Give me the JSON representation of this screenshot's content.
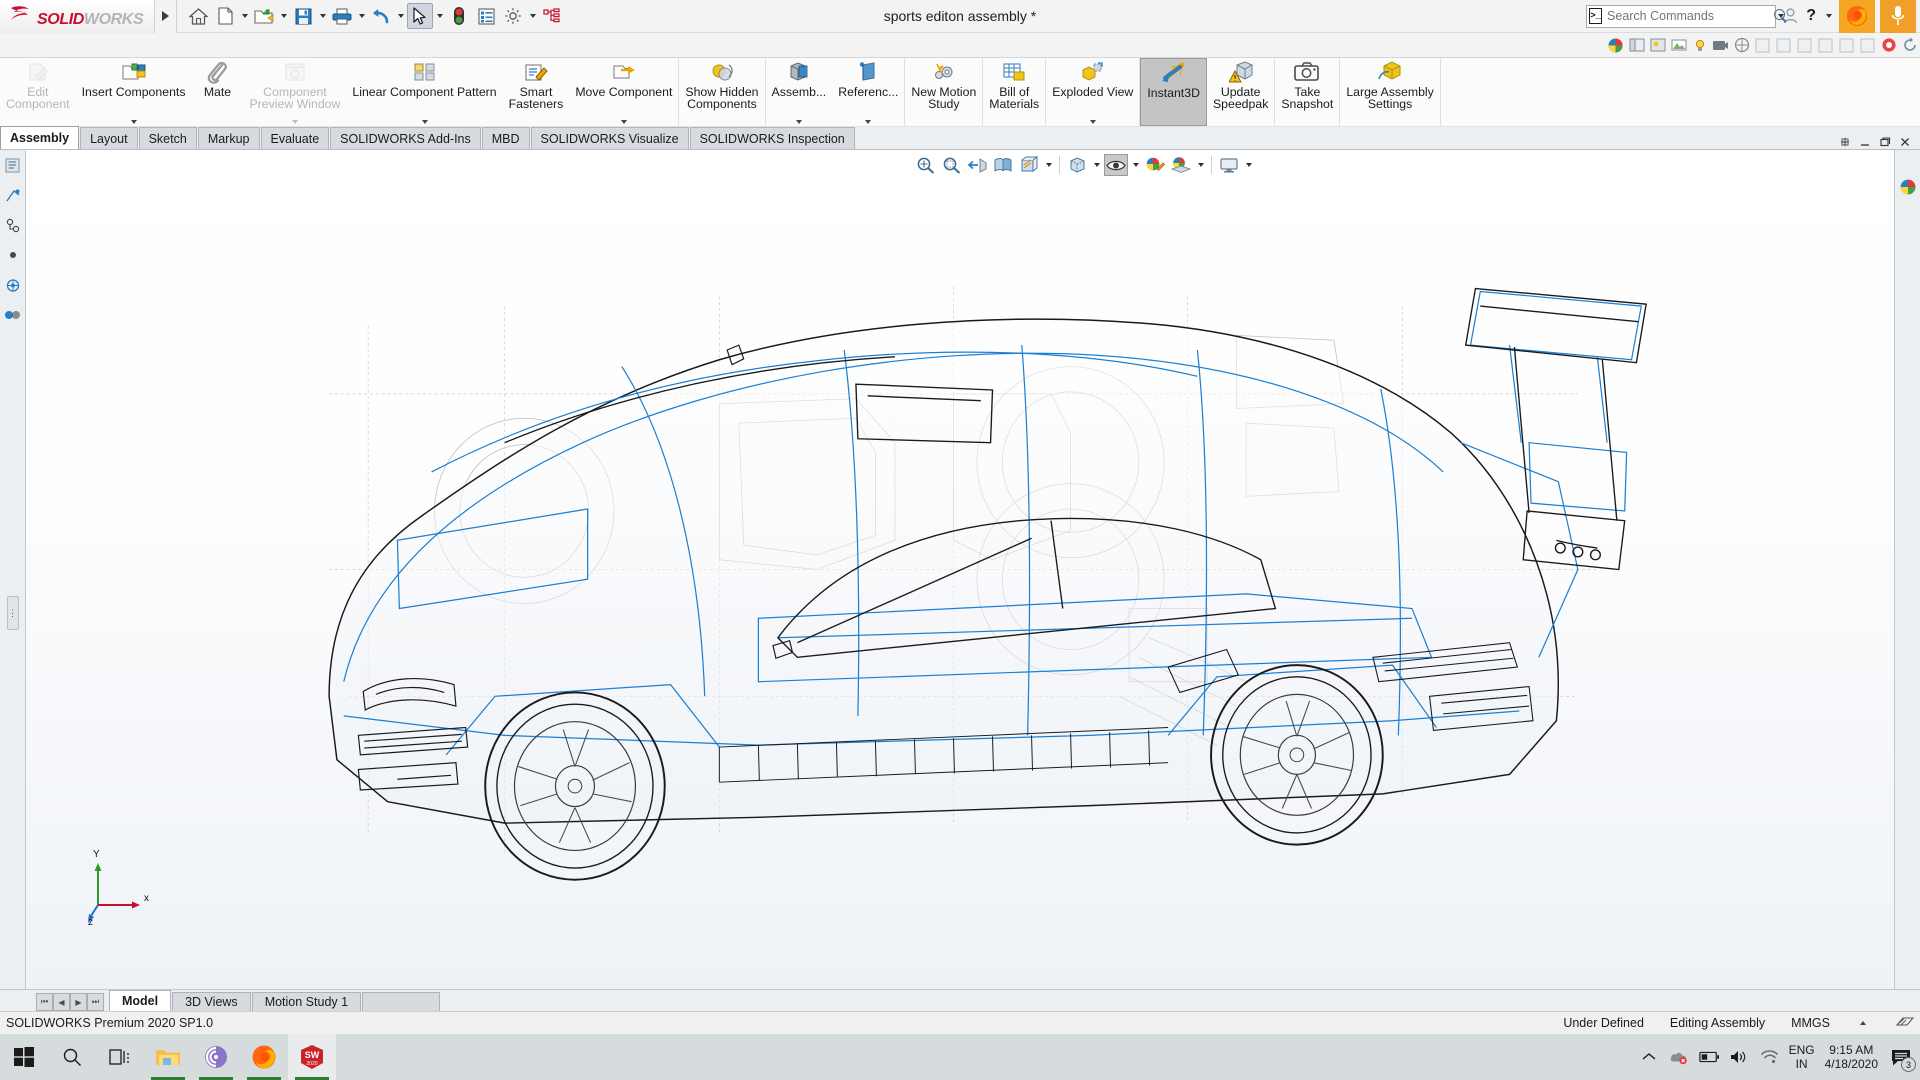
{
  "app": {
    "brand_mark": "3DS",
    "brand_solid": "SOLID",
    "brand_works": "WORKS",
    "window_title": "sports editon assembly *",
    "accent_red": "#c8102e",
    "accent_blue": "#2a7fc1"
  },
  "quick_access": [
    {
      "name": "home-icon",
      "label": "Home",
      "dropdown": false
    },
    {
      "name": "new-document-icon",
      "label": "New",
      "dropdown": true
    },
    {
      "name": "open-folder-icon",
      "label": "Open",
      "dropdown": true
    },
    {
      "name": "save-icon",
      "label": "Save",
      "dropdown": true
    },
    {
      "name": "print-icon",
      "label": "Print",
      "dropdown": true
    },
    {
      "name": "undo-icon",
      "label": "Undo",
      "dropdown": true
    },
    {
      "name": "select-cursor-icon",
      "label": "Select",
      "dropdown": true,
      "selected": true
    },
    {
      "name": "rebuild-icon",
      "label": "Rebuild",
      "dropdown": false
    },
    {
      "name": "options-list-icon",
      "label": "Options List",
      "dropdown": false
    },
    {
      "name": "gear-icon",
      "label": "Options",
      "dropdown": true
    },
    {
      "name": "tree-display-icon",
      "label": "Tree Display",
      "dropdown": false
    }
  ],
  "search": {
    "placeholder": "Search Commands",
    "value": ""
  },
  "title_actions": {
    "user_label": "User",
    "help_label": "?",
    "firefox_label": "Firefox",
    "mic_label": "Microphone"
  },
  "ribbon": {
    "buttons": [
      {
        "label": "Edit\nComponent",
        "name": "edit-component-button",
        "icon": "edit-component-icon",
        "disabled": true,
        "dropdown": false,
        "group_end": false
      },
      {
        "label": "Insert Components",
        "name": "insert-components-button",
        "icon": "insert-components-icon",
        "disabled": false,
        "dropdown": true,
        "group_end": false
      },
      {
        "label": "Mate",
        "name": "mate-button",
        "icon": "paperclip-mate-icon",
        "disabled": false,
        "dropdown": false,
        "group_end": false
      },
      {
        "label": "Component\nPreview Window",
        "name": "component-preview-window-button",
        "icon": "component-preview-icon",
        "disabled": true,
        "dropdown": true,
        "group_end": false
      },
      {
        "label": "Linear Component Pattern",
        "name": "linear-component-pattern-button",
        "icon": "linear-pattern-icon",
        "disabled": false,
        "dropdown": true,
        "group_end": false
      },
      {
        "label": "Smart\nFasteners",
        "name": "smart-fasteners-button",
        "icon": "smart-fasteners-icon",
        "disabled": false,
        "dropdown": false,
        "group_end": false
      },
      {
        "label": "Move Component",
        "name": "move-component-button",
        "icon": "move-component-icon",
        "disabled": false,
        "dropdown": true,
        "group_end": true
      },
      {
        "label": "Show Hidden\nComponents",
        "name": "show-hidden-components-button",
        "icon": "show-hidden-icon",
        "disabled": false,
        "dropdown": false,
        "group_end": true
      },
      {
        "label": "Assemb...",
        "name": "assembly-features-button",
        "icon": "assembly-features-icon",
        "disabled": false,
        "dropdown": true,
        "group_end": false
      },
      {
        "label": "Referenc...",
        "name": "reference-geometry-button",
        "icon": "reference-geometry-icon",
        "disabled": false,
        "dropdown": true,
        "group_end": true
      },
      {
        "label": "New Motion\nStudy",
        "name": "new-motion-study-button",
        "icon": "motion-study-icon",
        "disabled": false,
        "dropdown": false,
        "group_end": true
      },
      {
        "label": "Bill of\nMaterials",
        "name": "bill-of-materials-button",
        "icon": "bom-icon",
        "disabled": false,
        "dropdown": false,
        "group_end": true
      },
      {
        "label": "Exploded View",
        "name": "exploded-view-button",
        "icon": "exploded-view-icon",
        "disabled": false,
        "dropdown": true,
        "group_end": true
      },
      {
        "label": "Instant3D",
        "name": "instant3d-button",
        "icon": "instant3d-icon",
        "disabled": false,
        "dropdown": false,
        "active": true,
        "group_end": false
      },
      {
        "label": "Update\nSpeedpak",
        "name": "update-speedpak-button",
        "icon": "update-speedpak-icon",
        "disabled": false,
        "dropdown": false,
        "group_end": true
      },
      {
        "label": "Take\nSnapshot",
        "name": "take-snapshot-button",
        "icon": "camera-icon",
        "disabled": false,
        "dropdown": false,
        "group_end": true
      },
      {
        "label": "Large Assembly\nSettings",
        "name": "large-assembly-settings-button",
        "icon": "large-assembly-icon",
        "disabled": false,
        "dropdown": false,
        "group_end": false
      }
    ]
  },
  "tabs": [
    {
      "label": "Assembly",
      "name": "tab-assembly",
      "active": true
    },
    {
      "label": "Layout",
      "name": "tab-layout",
      "active": false
    },
    {
      "label": "Sketch",
      "name": "tab-sketch",
      "active": false
    },
    {
      "label": "Markup",
      "name": "tab-markup",
      "active": false
    },
    {
      "label": "Evaluate",
      "name": "tab-evaluate",
      "active": false
    },
    {
      "label": "SOLIDWORKS Add-Ins",
      "name": "tab-solidworks-add-ins",
      "active": false
    },
    {
      "label": "MBD",
      "name": "tab-mbd",
      "active": false
    },
    {
      "label": "SOLIDWORKS Visualize",
      "name": "tab-solidworks-visualize",
      "active": false
    },
    {
      "label": "SOLIDWORKS Inspection",
      "name": "tab-solidworks-inspection",
      "active": false
    }
  ],
  "window_controls": {
    "pin": "pin-icon",
    "minimize": "minimize-icon",
    "restore": "restore-icon",
    "close": "close-icon"
  },
  "heads_up_view": [
    {
      "name": "zoom-to-fit-icon",
      "label": "Zoom to Fit"
    },
    {
      "name": "zoom-to-area-icon",
      "label": "Zoom to Area"
    },
    {
      "name": "previous-view-icon",
      "label": "Previous View"
    },
    {
      "name": "section-view-icon",
      "label": "Section View"
    },
    {
      "name": "view-orientation-icon",
      "label": "View Orientation"
    },
    {
      "name": "display-style-icon",
      "label": "Display Style"
    },
    {
      "name": "hide-show-items-icon",
      "label": "Hide/Show Items",
      "selected": true
    },
    {
      "name": "edit-appearance-icon",
      "label": "Edit Appearance"
    },
    {
      "name": "apply-scene-icon",
      "label": "Apply Scene"
    },
    {
      "name": "view-settings-icon",
      "label": "View Settings"
    }
  ],
  "feature_panel_icons": [
    {
      "name": "feature-tree-icon",
      "label": "FeatureManager Design Tree"
    },
    {
      "name": "property-manager-icon",
      "label": "PropertyManager"
    },
    {
      "name": "configuration-manager-icon",
      "label": "ConfigurationManager"
    },
    {
      "name": "dimxpert-manager-icon",
      "label": "DimXpertManager"
    },
    {
      "name": "display-manager-icon",
      "label": "DisplayManager"
    },
    {
      "name": "appearance-manager-icon",
      "label": "Appearances"
    }
  ],
  "triad": {
    "x_label": "x",
    "y_label": "Y",
    "z_label": "z"
  },
  "bottom_tabs": [
    {
      "label": "Model",
      "name": "bottom-tab-model",
      "active": true
    },
    {
      "label": "3D Views",
      "name": "bottom-tab-3d-views",
      "active": false
    },
    {
      "label": "Motion Study 1",
      "name": "bottom-tab-motion-study-1",
      "active": false
    }
  ],
  "nav_buttons": [
    {
      "name": "first-tab-button",
      "glyph": "⏮"
    },
    {
      "name": "previous-tab-button",
      "glyph": "◀"
    },
    {
      "name": "next-tab-button",
      "glyph": "▶"
    },
    {
      "name": "last-tab-button",
      "glyph": "⏭"
    }
  ],
  "statusbar": {
    "version": "SOLIDWORKS Premium 2020 SP1.0",
    "defined_state": "Under Defined",
    "edit_mode": "Editing Assembly",
    "units": "MMGS",
    "overlay_icon": "document-overlay-icon"
  },
  "taskbar": {
    "items": [
      {
        "name": "start-button",
        "label": "Start",
        "running": false,
        "active": false
      },
      {
        "name": "taskbar-search-button",
        "label": "Search",
        "running": false,
        "active": false
      },
      {
        "name": "task-view-button",
        "label": "Task View",
        "running": false,
        "active": false
      },
      {
        "name": "file-explorer-button",
        "label": "File Explorer",
        "running": true,
        "active": false
      },
      {
        "name": "bittorrent-button",
        "label": "BitTorrent",
        "running": true,
        "active": false
      },
      {
        "name": "firefox-button",
        "label": "Firefox",
        "running": true,
        "active": false
      },
      {
        "name": "solidworks-button",
        "label": "SOLIDWORKS 2020",
        "running": true,
        "active": true,
        "badge": "2020"
      }
    ],
    "tray": {
      "show_hidden": "show-hidden-icons-chevron",
      "onedrive": "onedrive-error-icon",
      "battery": "battery-icon",
      "volume": "volume-icon",
      "wifi": "wifi-icon",
      "language_line1": "ENG",
      "language_line2": "IN",
      "time": "9:15 AM",
      "date": "4/18/2020",
      "notification_count": "3"
    }
  }
}
